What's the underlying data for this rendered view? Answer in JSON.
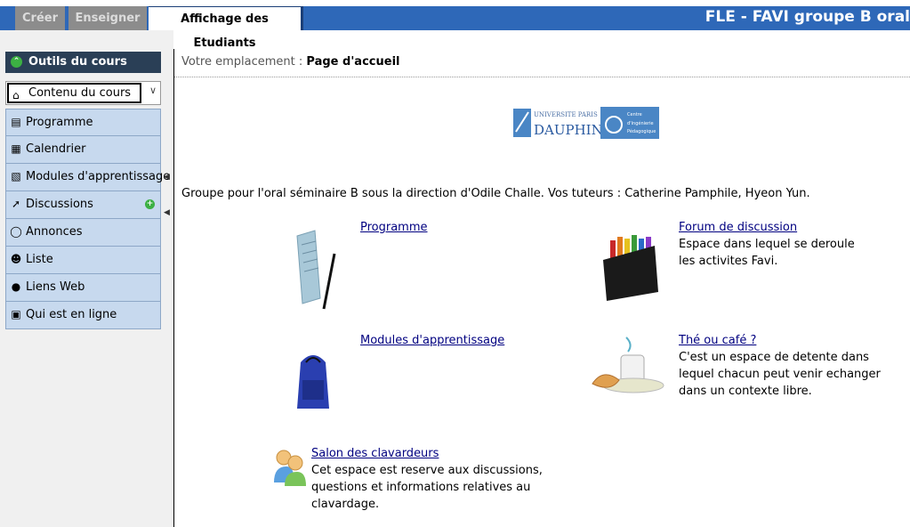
{
  "topbar": {
    "tabs": [
      {
        "label": "Créer"
      },
      {
        "label": "Enseigner"
      },
      {
        "label": "Affichage des Etudiants"
      }
    ],
    "course_title": "FLE - FAVI groupe B oral",
    "colors": {
      "bar": "#2e68b8",
      "inactive_tab": "#8c8c8c"
    }
  },
  "sidebar": {
    "header": "Outils du cours",
    "select_value": "Contenu du cours",
    "items": [
      {
        "label": "Programme",
        "icon": "document-icon"
      },
      {
        "label": "Calendrier",
        "icon": "calendar-icon"
      },
      {
        "label": "Modules d'apprentissage",
        "icon": "module-icon"
      },
      {
        "label": "Discussions",
        "icon": "pin-icon"
      },
      {
        "label": "Annonces",
        "icon": "megaphone-icon"
      },
      {
        "label": "Liste",
        "icon": "people-icon"
      },
      {
        "label": "Liens Web",
        "icon": "globe-icon"
      },
      {
        "label": "Qui est en ligne",
        "icon": "user-online-icon"
      }
    ]
  },
  "main": {
    "breadcrumb_prefix": "Votre emplacement :",
    "breadcrumb_current": "Page d'accueil",
    "logo": {
      "university": "UNIVERSITE PARIS",
      "name": "DAUPHINE",
      "center_line1": "Centre",
      "center_line2": "d'Ingénierie",
      "center_line3": "Pédagogique"
    },
    "intro": "Groupe pour l'oral séminaire B sous la direction d'Odile Challe. Vos tuteurs : Catherine Pamphile, Hyeon Yun.",
    "entries": [
      {
        "title": "Programme",
        "desc": ""
      },
      {
        "title": "Forum de discussion",
        "desc": "Espace dans lequel se deroule les activites Favi."
      },
      {
        "title": "Modules d'apprentissage",
        "desc": ""
      },
      {
        "title": "Thé ou café ?",
        "desc": "C'est un espace de detente dans lequel chacun peut venir echanger dans un contexte libre."
      },
      {
        "title": "Salon des clavardeurs",
        "desc": "Cet espace est reserve aux discussions, questions et informations relatives au clavardage."
      }
    ]
  }
}
